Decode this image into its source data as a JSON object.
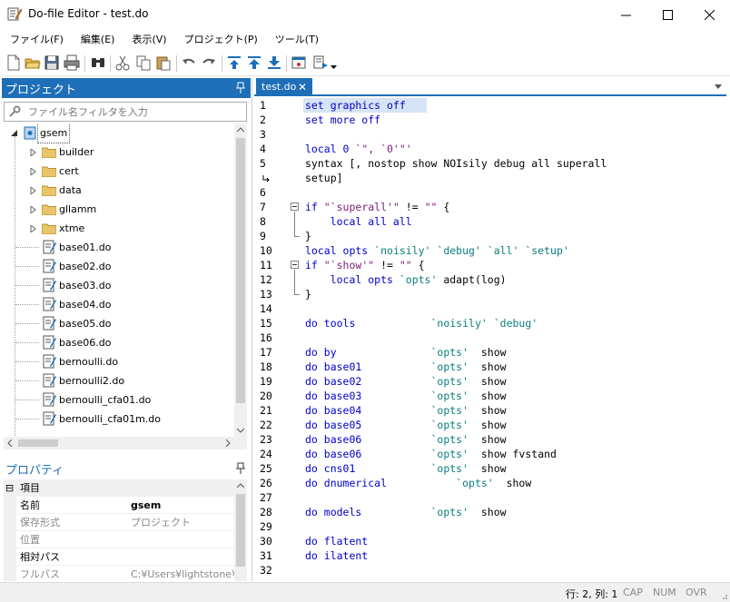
{
  "window": {
    "title": "Do-file Editor - test.do",
    "minimize_glyph": "—",
    "maximize_glyph": "☐",
    "close_glyph": "✕"
  },
  "menu": [
    "ファイル(F)",
    "編集(E)",
    "表示(V)",
    "プロジェクト(P)",
    "ツール(T)"
  ],
  "toolbar": {
    "icons": [
      "new-file-icon",
      "open-folder-icon",
      "save-icon",
      "print-icon",
      "find-icon",
      "cut-icon",
      "copy-icon",
      "paste-icon",
      "undo-icon",
      "redo-icon",
      "indent-icon",
      "move-up-icon",
      "move-down-icon",
      "show-window-icon",
      "execute-icon"
    ]
  },
  "project_panel": {
    "title": "プロジェクト",
    "filter_placeholder": "ファイル名フィルタを入力",
    "root": "gsem",
    "folders": [
      "builder",
      "cert",
      "data",
      "gllamm",
      "xtme"
    ],
    "files": [
      "base01.do",
      "base02.do",
      "base03.do",
      "base04.do",
      "base05.do",
      "base06.do",
      "bernoulli.do",
      "bernoulli2.do",
      "bernoulli_cfa01.do",
      "bernoulli_cfa01m.do"
    ]
  },
  "properties_panel": {
    "title": "プロパティ",
    "section": "項目",
    "section_toggle": "⊟",
    "rows": [
      {
        "key": "名前",
        "value": "gsem",
        "bold": true
      },
      {
        "key": "保存形式",
        "value": "プロジェクト",
        "bold": false
      },
      {
        "key": "位置",
        "value": "",
        "bold": false
      },
      {
        "key": "相対パス",
        "value": "",
        "bold": false
      },
      {
        "key": "フルパス",
        "value": "C:¥Users¥lightstone¥",
        "bold": false
      }
    ]
  },
  "editor": {
    "tab_label": "test.do",
    "tab_close": "✕",
    "lines": [
      [
        {
          "t": "set graphics off",
          "c": "kw"
        }
      ],
      [
        {
          "t": "set more off",
          "c": "kw"
        }
      ],
      [],
      [
        {
          "t": "local 0 ",
          "c": "kw"
        },
        {
          "t": "`\", `0'\"'",
          "c": "str"
        }
      ],
      [
        {
          "t": "syntax [, nostop show NOIsily debug all superall",
          "c": ""
        }
      ],
      [
        {
          "t": "setup]",
          "c": ""
        }
      ],
      [],
      [
        {
          "t": "if ",
          "c": "kw"
        },
        {
          "t": "\"`superall'\"",
          "c": "str"
        },
        {
          "t": " != ",
          "c": ""
        },
        {
          "t": "\"\"",
          "c": "str"
        },
        {
          "t": " {",
          "c": ""
        }
      ],
      [
        {
          "t": "    local all all",
          "c": "kw"
        }
      ],
      [
        {
          "t": "}",
          "c": ""
        }
      ],
      [
        {
          "t": "local opts ",
          "c": "kw"
        },
        {
          "t": "`noisily' `debug' `all' `setup'",
          "c": "mac"
        }
      ],
      [
        {
          "t": "if ",
          "c": "kw"
        },
        {
          "t": "\"`show'\"",
          "c": "str"
        },
        {
          "t": " != ",
          "c": ""
        },
        {
          "t": "\"\"",
          "c": "str"
        },
        {
          "t": " {",
          "c": ""
        }
      ],
      [
        {
          "t": "    local opts ",
          "c": "kw"
        },
        {
          "t": "`opts'",
          "c": "mac"
        },
        {
          "t": " adapt(log)",
          "c": ""
        }
      ],
      [
        {
          "t": "}",
          "c": ""
        }
      ],
      [],
      [
        {
          "t": "do tools            ",
          "c": "kw"
        },
        {
          "t": "`noisily' `debug'",
          "c": "mac"
        }
      ],
      [],
      [
        {
          "t": "do by               ",
          "c": "kw"
        },
        {
          "t": "`opts'",
          "c": "mac"
        },
        {
          "t": "  show",
          "c": ""
        }
      ],
      [
        {
          "t": "do base01           ",
          "c": "kw"
        },
        {
          "t": "`opts'",
          "c": "mac"
        },
        {
          "t": "  show",
          "c": ""
        }
      ],
      [
        {
          "t": "do base02           ",
          "c": "kw"
        },
        {
          "t": "`opts'",
          "c": "mac"
        },
        {
          "t": "  show",
          "c": ""
        }
      ],
      [
        {
          "t": "do base03           ",
          "c": "kw"
        },
        {
          "t": "`opts'",
          "c": "mac"
        },
        {
          "t": "  show",
          "c": ""
        }
      ],
      [
        {
          "t": "do base04           ",
          "c": "kw"
        },
        {
          "t": "`opts'",
          "c": "mac"
        },
        {
          "t": "  show",
          "c": ""
        }
      ],
      [
        {
          "t": "do base05           ",
          "c": "kw"
        },
        {
          "t": "`opts'",
          "c": "mac"
        },
        {
          "t": "  show",
          "c": ""
        }
      ],
      [
        {
          "t": "do base06           ",
          "c": "kw"
        },
        {
          "t": "`opts'",
          "c": "mac"
        },
        {
          "t": "  show",
          "c": ""
        }
      ],
      [
        {
          "t": "do base06           ",
          "c": "kw"
        },
        {
          "t": "`opts'",
          "c": "mac"
        },
        {
          "t": "  show fvstand",
          "c": ""
        }
      ],
      [
        {
          "t": "do cns01            ",
          "c": "kw"
        },
        {
          "t": "`opts'",
          "c": "mac"
        },
        {
          "t": "  show",
          "c": ""
        }
      ],
      [
        {
          "t": "do dnumerical           ",
          "c": "kw"
        },
        {
          "t": "`opts'",
          "c": "mac"
        },
        {
          "t": "  show",
          "c": ""
        }
      ],
      [],
      [
        {
          "t": "do models           ",
          "c": "kw"
        },
        {
          "t": "`opts'",
          "c": "mac"
        },
        {
          "t": "  show",
          "c": ""
        }
      ],
      [],
      [
        {
          "t": "do flatent",
          "c": "kw"
        }
      ],
      [
        {
          "t": "do ilatent",
          "c": "kw"
        }
      ],
      []
    ],
    "line_numbers": [
      "1",
      "2",
      "3",
      "4",
      "5",
      "",
      "6",
      "7",
      "8",
      "9",
      "10",
      "11",
      "12",
      "13",
      "14",
      "15",
      "16",
      "17",
      "18",
      "19",
      "20",
      "21",
      "22",
      "23",
      "24",
      "25",
      "26",
      "27",
      "28",
      "29",
      "30",
      "31",
      "32"
    ]
  },
  "status": {
    "position": "行: 2, 列: 1",
    "cap": "CAP",
    "num": "NUM",
    "ovr": "OVR"
  },
  "colors": {
    "accent": "#1e6fb8",
    "keyword": "#0000cc",
    "string": "#7a1e7a",
    "macro": "#0b7b7b",
    "selection": "#d6e4f5"
  }
}
